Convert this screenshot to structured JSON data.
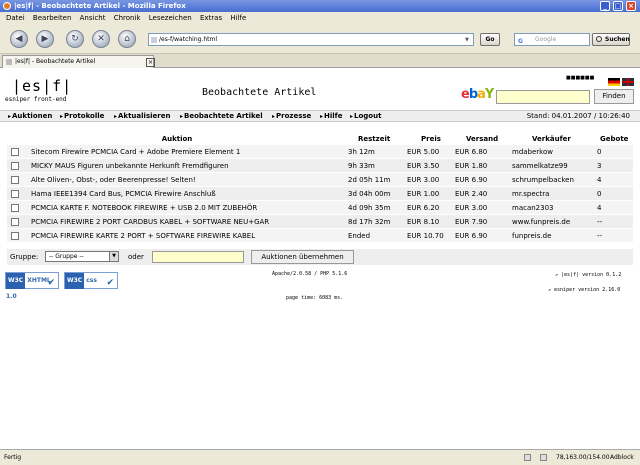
{
  "window": {
    "title": "|es|f| - Beobachtete Artikel - Mozilla Firefox"
  },
  "menu": [
    "Datei",
    "Bearbeiten",
    "Ansicht",
    "Chronik",
    "Lesezeichen",
    "Extras",
    "Hilfe"
  ],
  "toolbar": {
    "url": "/es-f/watching.html",
    "go": "Go",
    "search_placeholder": "Google",
    "search_button": "Suchen"
  },
  "tab": {
    "title": "|es|f| - Beobachtete Artikel"
  },
  "header": {
    "logo": "|es|f|",
    "logo_sub": "esniper front-end",
    "page_title": "Beobachtete Artikel",
    "find_button": "Finden"
  },
  "nav": {
    "items": [
      "Auktionen",
      "Protokolle",
      "Aktualisieren",
      "Beobachtete Artikel",
      "Prozesse",
      "Hilfe",
      "Logout"
    ],
    "status": "Stand: 04.01.2007 / 10:26:40"
  },
  "table": {
    "headers": [
      "Auktion",
      "Restzeit",
      "Preis",
      "Versand",
      "Verkäufer",
      "Gebote"
    ],
    "rows": [
      [
        "Sitecom Firewire PCMCIA Card + Adobe Premiere Element 1",
        "3h 12m",
        "EUR 5.00",
        "EUR 6.80",
        "mdaberkow",
        "0"
      ],
      [
        "MICKY MAUS Figuren unbekannte Herkunft Fremdfiguren",
        "9h 33m",
        "EUR 3.50",
        "EUR 1.80",
        "sammelkatze99",
        "3"
      ],
      [
        "Alte Oliven-, Obst-, oder Beerenpresse! Selten!",
        "2d 05h 11m",
        "EUR 3.00",
        "EUR 6.90",
        "schrumpelbacken",
        "4"
      ],
      [
        "Hama IEEE1394 Card Bus, PCMCIA Firewire Anschluß",
        "3d 04h 00m",
        "EUR 1.00",
        "EUR 2.40",
        "mr.spectra",
        "0"
      ],
      [
        "PCMCIA KARTE F. NOTEBOOK FIREWIRE + USB 2.0 MIT ZUBEHÖR",
        "4d 09h 35m",
        "EUR 6.20",
        "EUR 3.00",
        "macan2303",
        "4"
      ],
      [
        "PCMCIA FIREWIRE 2 PORT CARDBUS KABEL + SOFTWARE NEU+GAR",
        "8d 17h 32m",
        "EUR 8.10",
        "EUR 7.90",
        "www.funpreis.de",
        "--"
      ],
      [
        "PCMCIA FIREWIRE KARTE 2 PORT + SOFTWARE FIREWIRE KABEL",
        "Ended",
        "EUR 10.70",
        "EUR 6.90",
        "funpreis.de",
        "--"
      ]
    ]
  },
  "group": {
    "label": "Gruppe:",
    "select_value": "-- Gruppe --",
    "or_label": "oder",
    "apply_button": "Auktionen übernehmen"
  },
  "badges": {
    "w3c": "W3C",
    "xhtml": "XHTML 1.0",
    "css": "css"
  },
  "footer": {
    "server": "Apache/2.0.58 / PHP 5.1.6",
    "page_time": "page time: 6083 ms.",
    "esf_version": "|es|f| version 0.1.2",
    "esniper_version": "esniper version 2.16.0"
  },
  "statusbar": {
    "text": "Fertig",
    "ip": "78,163.00/154.00",
    "adblock": "Adblock"
  }
}
